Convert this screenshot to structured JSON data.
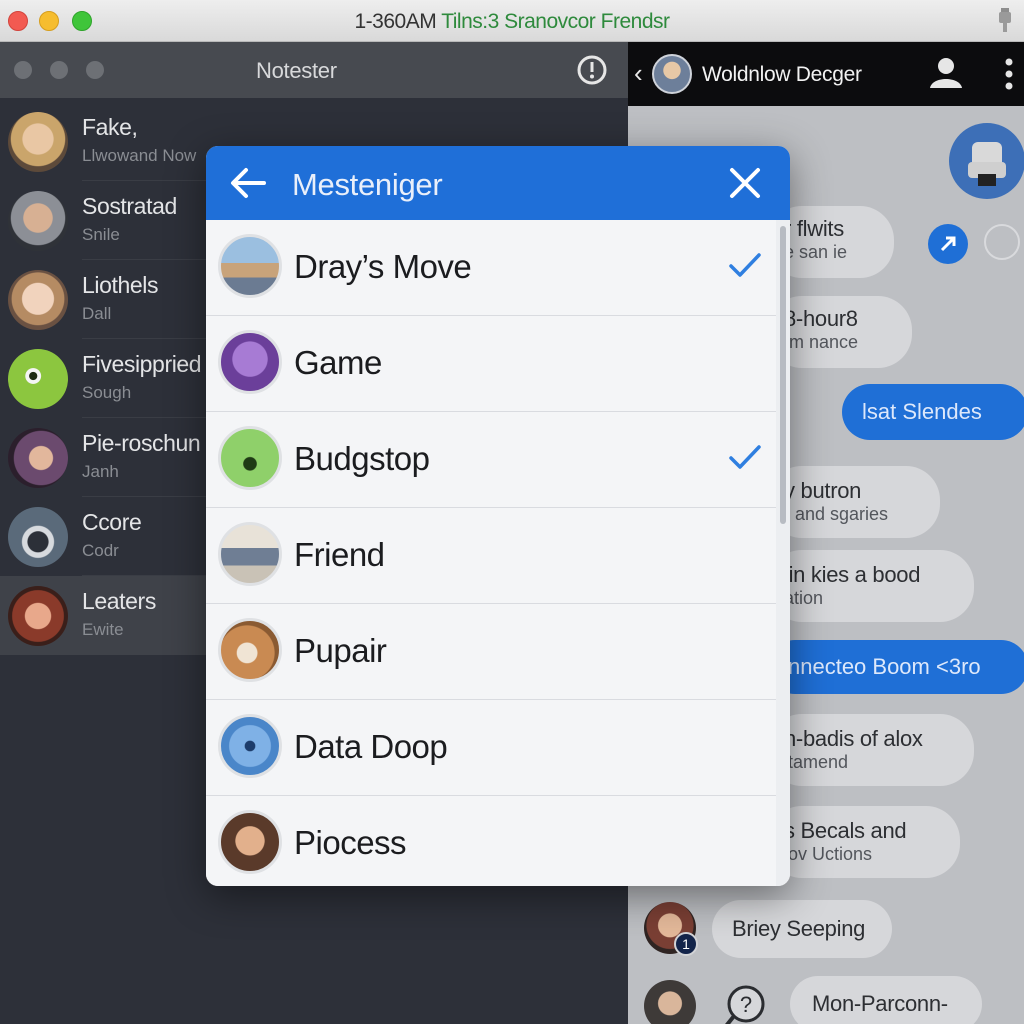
{
  "window": {
    "title_time": "1-360AM",
    "title_app": "Tilns:3 Sranovcor Frendsr"
  },
  "sidebar": {
    "title": "Notester",
    "contacts": [
      {
        "name": "Fake,",
        "subtitle": "Llwowand Now"
      },
      {
        "name": "Sostratad",
        "subtitle": "Snile"
      },
      {
        "name": "Liothels",
        "subtitle": "Dall"
      },
      {
        "name": "Fivesippried",
        "subtitle": "Sough"
      },
      {
        "name": "Pie-roschun",
        "subtitle": "Janh"
      },
      {
        "name": "Ccore",
        "subtitle": "Codr"
      },
      {
        "name": "Leaters",
        "subtitle": "Ewite"
      }
    ]
  },
  "chat": {
    "title": "Woldnlow Decger",
    "messages": [
      {
        "line1": "r flwits",
        "line2": "e san ie"
      },
      {
        "line1": "8-hour8",
        "line2": "Im nance"
      },
      {
        "text": "lsat Slendes"
      },
      {
        "line1": "y butron",
        "line2": "r and sgaries"
      },
      {
        "line1": "lin kies a bood",
        "line2": "ation"
      },
      {
        "text": "nnecteo Boom <3ro"
      },
      {
        "line1": "n-badis of alox",
        "line2": "itamend"
      },
      {
        "line1": "s Becals and",
        "line2": "lov Uctions"
      },
      {
        "text": "Briey Seeping"
      },
      {
        "text": "Mon-Parconn-"
      }
    ],
    "badge_count": "1"
  },
  "modal": {
    "title": "Mesteniger",
    "items": [
      {
        "label": "Dray’s Move",
        "checked": true
      },
      {
        "label": "Game",
        "checked": false
      },
      {
        "label": "Budgstop",
        "checked": true
      },
      {
        "label": "Friend",
        "checked": false
      },
      {
        "label": "Pupair",
        "checked": false
      },
      {
        "label": "Data Doop",
        "checked": false
      },
      {
        "label": "Piocess",
        "checked": false
      }
    ]
  },
  "colors": {
    "accent_blue": "#1f6fd8",
    "sidebar_bg": "#2d3039",
    "chat_bg": "#bdbfc3",
    "check_blue": "#2f7fe0"
  },
  "icons": {
    "window": [
      "close-traffic-light",
      "minimize-traffic-light",
      "zoom-traffic-light",
      "battery-icon"
    ],
    "sidebar_header": [
      "compass-icon"
    ],
    "chat_header": [
      "chevron-left-icon",
      "person-icon",
      "more-vertical-icon"
    ],
    "modal": [
      "arrow-left-icon",
      "close-icon",
      "checkmark-icon"
    ]
  }
}
